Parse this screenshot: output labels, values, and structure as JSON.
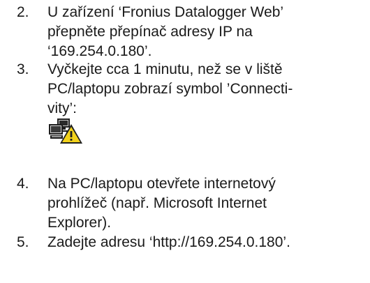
{
  "steps": [
    {
      "number": "2.",
      "lines": [
        "U zařízení ‘Fronius Datalogger Web’",
        "přepněte přepínač adresy IP na",
        "‘169.254.0.180’."
      ]
    },
    {
      "number": "3.",
      "lines": [
        "Vyčkejte cca 1 minutu, než se v liště",
        "PC/laptopu zobrazí symbol ’Connecti-",
        "vity’:"
      ]
    },
    {
      "number": "4.",
      "lines": [
        "Na PC/laptopu otevřete internetový",
        "prohlížeč (např. Microsoft Internet",
        "Explorer)."
      ]
    },
    {
      "number": "5.",
      "lines": [
        "Zadejte adresu ‘http://169.254.0.180’."
      ]
    }
  ],
  "icons": {
    "connectivity": "network-warning-icon",
    "warning_color": "#f2d21b",
    "computer_color": "#1f1f1f"
  }
}
